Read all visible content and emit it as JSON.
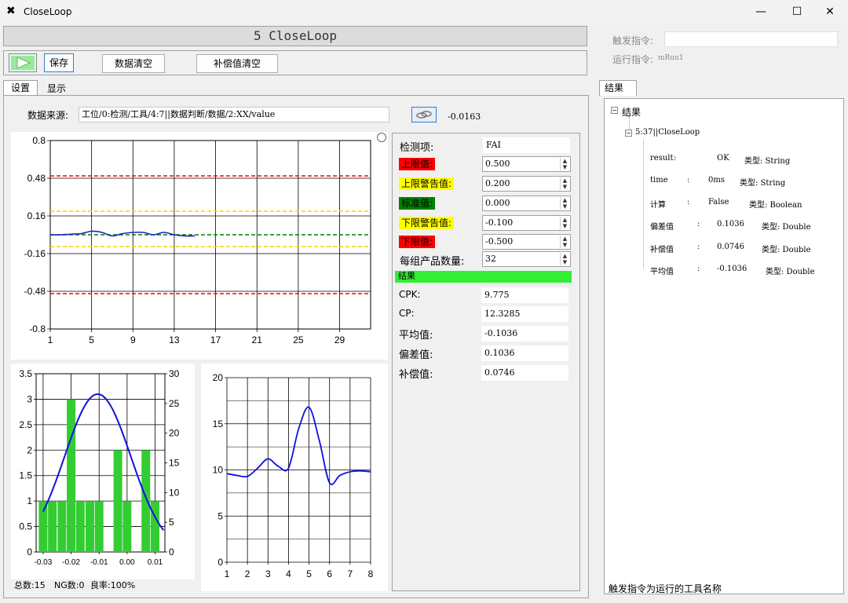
{
  "window": {
    "title": "CloseLoop",
    "minimize": "—",
    "maximize": "☐",
    "close": "✕"
  },
  "header": {
    "title": "5 CloseLoop"
  },
  "toolbar": {
    "save": "保存",
    "clear_data": "数据清空",
    "clear_comp": "补偿值清空"
  },
  "tabs": {
    "settings": "设置",
    "display": "显示"
  },
  "source": {
    "label": "数据来源:",
    "value": "工位/0:检测/工具/4:7||数据判断/数据/2:XX/value",
    "reading": "-0.0163"
  },
  "limits": {
    "item_label": "检测项:",
    "item_value": "FAI",
    "upper_label": "上限值:",
    "upper_value": "0.500",
    "upper_warn_label": "上限警告值:",
    "upper_warn_value": "0.200",
    "std_label": "标准值:",
    "std_value": "0.000",
    "lower_warn_label": "下限警告值:",
    "lower_warn_value": "-0.100",
    "lower_label": "下限值:",
    "lower_value": "-0.500",
    "group_label": "每组产品数量:",
    "group_value": "32"
  },
  "results": {
    "header": "结果",
    "cpk_label": "CPK:",
    "cpk": "9.775",
    "cp_label": "CP:",
    "cp": "12.3285",
    "avg_label": "平均值:",
    "avg": "-0.1036",
    "dev_label": "偏差值:",
    "dev": "0.1036",
    "comp_label": "补偿值:",
    "comp": "0.0746"
  },
  "stats": {
    "total": "总数:15",
    "ng": "NG数:0",
    "yield": "良率:100%"
  },
  "right": {
    "trigger_label": "触发指令:",
    "trigger_value": "",
    "run_label": "运行指令:",
    "run_value": "mRun1",
    "tab": "结果",
    "tree_root": "结果",
    "tree_node": "5:37||CloseLoop",
    "tree_items": [
      {
        "name": "result",
        "value": "OK",
        "type": "类型: String"
      },
      {
        "name": "time",
        "value": "0ms",
        "type": "类型: String"
      },
      {
        "name": "计算",
        "value": "False",
        "type": "类型: Boolean"
      },
      {
        "name": "偏差值",
        "value": "0.1036",
        "type": "类型: Double"
      },
      {
        "name": "补偿值",
        "value": "0.0746",
        "type": "类型: Double"
      },
      {
        "name": "平均值",
        "value": "-0.1036",
        "type": "类型: Double"
      }
    ],
    "footer": "触发指令为运行的工具名称"
  },
  "colors": {
    "red": "#ff0000",
    "yellow": "#ffff00",
    "green": "#008000",
    "series": "#2020c0",
    "bar": "#33cc33",
    "result_bar": "#33ee33"
  },
  "chart_data": [
    {
      "type": "line",
      "x_ticks": [
        1,
        5,
        9,
        13,
        17,
        21,
        25,
        29
      ],
      "y_ticks": [
        0.8,
        0.48,
        0.16,
        -0.16,
        -0.48,
        -0.8
      ],
      "ylim": [
        -0.8,
        0.8
      ],
      "xlim": [
        1,
        32
      ],
      "limit_lines": [
        {
          "name": "上限值",
          "y": 0.5,
          "color": "#ff0000"
        },
        {
          "name": "上限警告值",
          "y": 0.2,
          "color": "#ffd000"
        },
        {
          "name": "标准值",
          "y": 0.0,
          "color": "#008000"
        },
        {
          "name": "下限警告值",
          "y": -0.1,
          "color": "#ffd000"
        },
        {
          "name": "下限值",
          "y": -0.5,
          "color": "#ff0000"
        }
      ],
      "x": [
        1,
        2,
        3,
        4,
        5,
        6,
        7,
        8,
        9,
        10,
        11,
        12,
        13,
        14,
        15
      ],
      "values": [
        0.0,
        0.0,
        0.005,
        0.01,
        0.03,
        0.02,
        -0.01,
        0.01,
        0.02,
        0.02,
        0.0,
        0.02,
        0.0,
        -0.01,
        -0.01
      ]
    },
    {
      "type": "bar",
      "categories": [
        "-0.03",
        "-0.02",
        "-0.01",
        "0.00",
        "0.01"
      ],
      "x_ticks": [
        -0.03,
        -0.02,
        -0.01,
        0.0,
        0.01
      ],
      "left_ticks": [
        0,
        0.5,
        1,
        1.5,
        2,
        2.5,
        3,
        3.5
      ],
      "right_ticks": [
        0,
        5,
        10,
        15,
        20,
        25,
        30
      ],
      "bars": [
        {
          "x": -0.03,
          "v": 1
        },
        {
          "x": -0.0267,
          "v": 1
        },
        {
          "x": -0.0233,
          "v": 1
        },
        {
          "x": -0.02,
          "v": 3
        },
        {
          "x": -0.0167,
          "v": 1
        },
        {
          "x": -0.0133,
          "v": 1
        },
        {
          "x": -0.01,
          "v": 1
        },
        {
          "x": -0.0033,
          "v": 2
        },
        {
          "x": 0.0,
          "v": 1
        },
        {
          "x": 0.0067,
          "v": 2
        },
        {
          "x": 0.01,
          "v": 1
        }
      ],
      "curve_peak": 3.1,
      "curve_center": -0.0105
    },
    {
      "type": "line",
      "x_ticks": [
        1,
        2,
        3,
        4,
        5,
        6,
        7,
        8
      ],
      "y_ticks": [
        0,
        5,
        10,
        15,
        20
      ],
      "ylim": [
        0,
        20
      ],
      "xlim": [
        1,
        8
      ],
      "x": [
        1,
        1.5,
        2,
        2.5,
        3,
        3.5,
        4,
        4.5,
        5,
        5.5,
        6,
        6.5,
        7,
        7.5,
        8
      ],
      "values": [
        9.6,
        9.4,
        9.3,
        10.2,
        11.2,
        10.4,
        10.2,
        14.5,
        16.8,
        13.2,
        8.6,
        9.4,
        9.8,
        9.9,
        9.8
      ]
    }
  ]
}
